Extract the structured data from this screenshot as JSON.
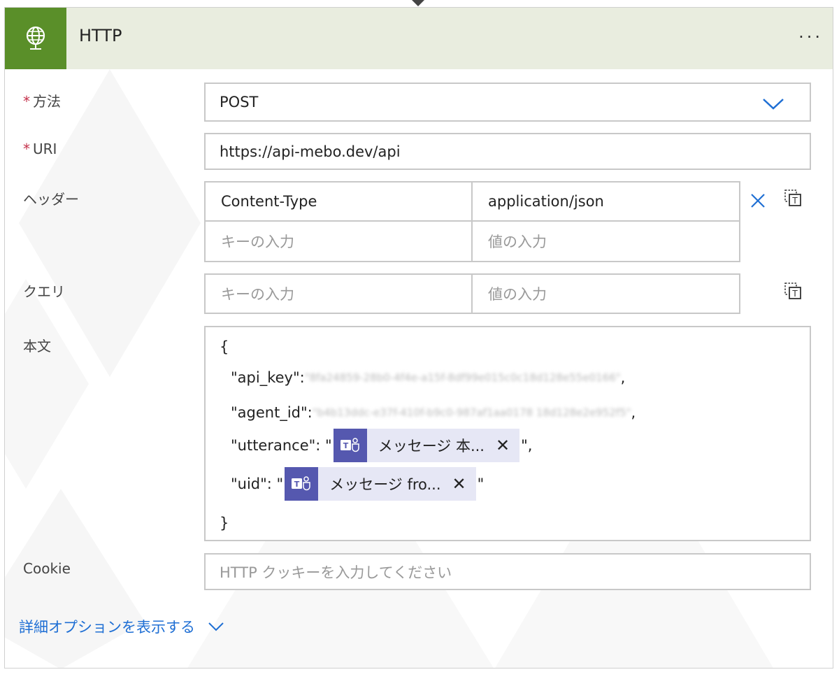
{
  "action": {
    "title": "HTTP",
    "more_label": "···",
    "accent_color": "#5a8f29"
  },
  "fields": {
    "method": {
      "required_mark": "*",
      "label": "方法",
      "value": "POST"
    },
    "uri": {
      "required_mark": "*",
      "label": "URI",
      "value": "https://api-mebo.dev/api"
    },
    "headers": {
      "label": "ヘッダー",
      "rows": [
        {
          "key": "Content-Type",
          "value": "application/json"
        }
      ],
      "key_placeholder": "キーの入力",
      "value_placeholder": "値の入力"
    },
    "queries": {
      "label": "クエリ",
      "key_placeholder": "キーの入力",
      "value_placeholder": "値の入力"
    },
    "body": {
      "label": "本文",
      "open_brace": "{",
      "close_brace": "}",
      "api_key_prefix": "\"api_key\": ",
      "api_key_value": "\"8fa24859-28b0-4f4e-a15f-8df99e015c0c18d128e55e0166\"",
      "comma": ",",
      "agent_id_prefix": "\"agent_id\": ",
      "agent_id_value": "\"b4b13ddc-e37f-410f-b9c0-987af1aa0178 18d128e2e952f5\"",
      "utterance_prefix": "\"utterance\": \"",
      "utterance_token": "メッセージ 本...",
      "utterance_suffix": "\",",
      "uid_prefix": "\"uid\": \"",
      "uid_token": "メッセージ fro...",
      "uid_suffix": "\"",
      "token_close": "✕"
    },
    "cookie": {
      "label": "Cookie",
      "placeholder": "HTTP クッキーを入力してください"
    }
  },
  "advanced_link": "詳細オプションを表示する"
}
